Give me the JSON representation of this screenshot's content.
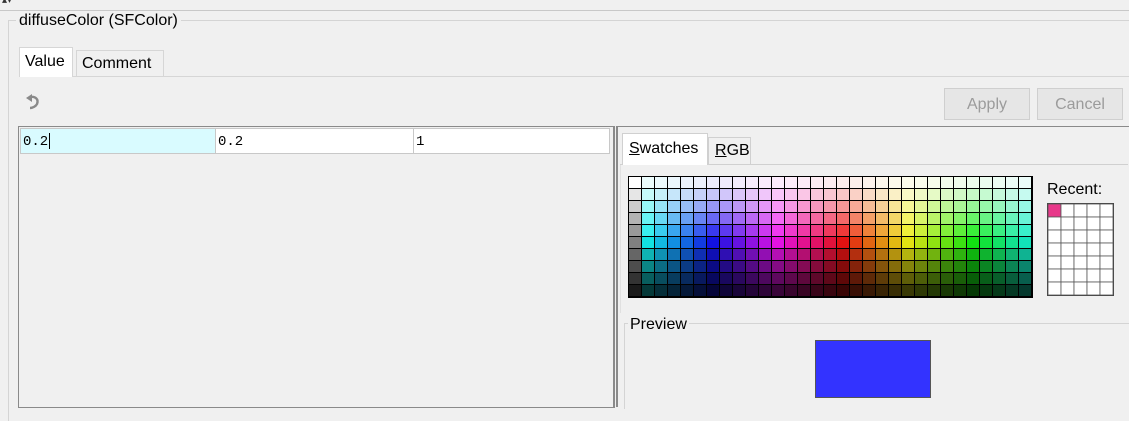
{
  "field": {
    "title": "diffuseColor (SFColor)"
  },
  "tabs": [
    {
      "label": "Value"
    },
    {
      "label": "Comment"
    }
  ],
  "toolbar": {
    "undo_icon": "undo-icon",
    "apply_label": "Apply",
    "cancel_label": "Cancel"
  },
  "values": {
    "r": "0.2",
    "g": "0.2",
    "b": "1"
  },
  "chooser": {
    "tabs": [
      {
        "mnemonic": "S",
        "rest": "watches"
      },
      {
        "mnemonic": "R",
        "rest": "GB"
      }
    ],
    "recent_label": "Recent:",
    "recent_colors": [
      "#e8388a"
    ],
    "preview_label": "Preview",
    "preview_color": "#3333ff"
  },
  "colors": {
    "selected_cell_bg": "#d9fbff",
    "disabled_text": "#9b9b9b"
  }
}
